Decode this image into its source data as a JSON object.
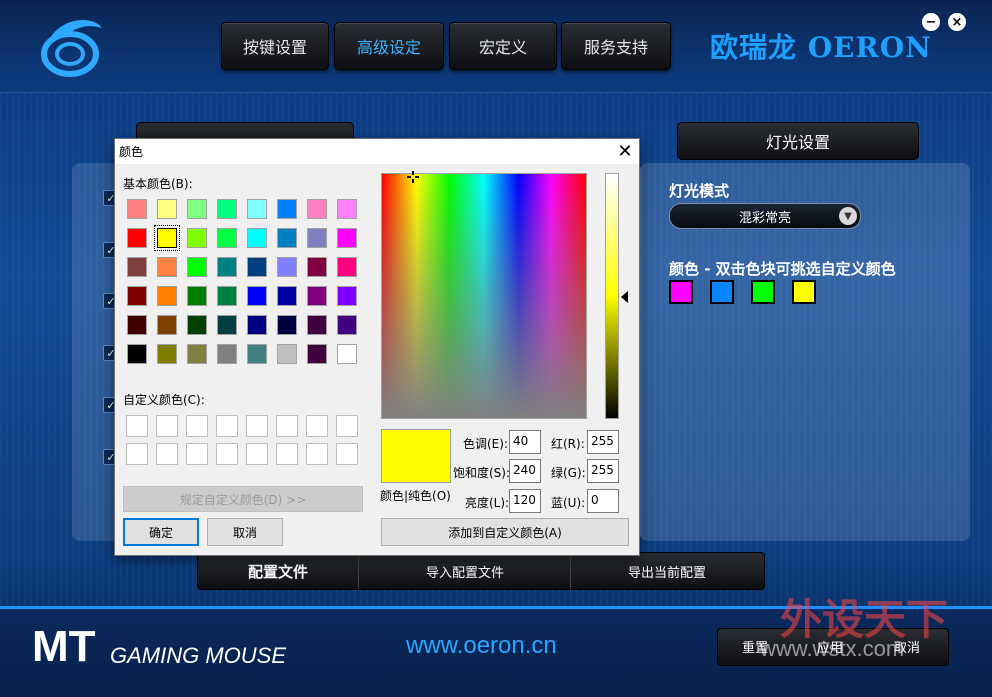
{
  "app": {
    "nav": [
      {
        "label": "按键设置",
        "active": false
      },
      {
        "label": "高级设定",
        "active": true
      },
      {
        "label": "宏定义",
        "active": false
      },
      {
        "label": "服务支持",
        "active": false
      }
    ],
    "brand": "欧瑞龙 OERON",
    "minimize_symbol": "−",
    "close_symbol": "×",
    "settings_tab_label": "",
    "light_tab_label": "灯光设置",
    "light_mode_label": "灯光模式",
    "light_mode_value": "混彩常亮",
    "color_label": "颜色 - 双击色块可挑选自定义颜色",
    "swatches": [
      "#ff00ff",
      "#0a84ff",
      "#00ff00",
      "#ffff00"
    ],
    "check_mark": "✓",
    "config": {
      "label": "配置文件",
      "import": "导入配置文件",
      "export": "导出当前配置"
    },
    "footer": {
      "mt": "MT",
      "gaming": "GAMING MOUSE",
      "site": "www.oeron.cn",
      "reset": "重置",
      "apply": "应用",
      "cancel": "取消"
    },
    "watermark": "外设天下",
    "watermark_site": "www.wstx.com"
  },
  "dialog": {
    "title": "颜色",
    "close": "✕",
    "basic_label": "基本颜色(B):",
    "custom_label": "自定义颜色(C):",
    "basic_colors": [
      [
        "#ff8080",
        "#ffff80",
        "#80ff80",
        "#00ff80",
        "#80ffff",
        "#0080ff",
        "#ff80c0",
        "#ff80ff"
      ],
      [
        "#ff0000",
        "#ffff00",
        "#80ff00",
        "#00ff40",
        "#00ffff",
        "#0080c0",
        "#8080c0",
        "#ff00ff"
      ],
      [
        "#804040",
        "#ff8040",
        "#00ff00",
        "#008080",
        "#004080",
        "#8080ff",
        "#800040",
        "#ff0080"
      ],
      [
        "#800000",
        "#ff8000",
        "#008000",
        "#008040",
        "#0000ff",
        "#0000a0",
        "#800080",
        "#8000ff"
      ],
      [
        "#400000",
        "#804000",
        "#004000",
        "#004040",
        "#000080",
        "#000040",
        "#400040",
        "#400080"
      ],
      [
        "#000000",
        "#808000",
        "#808040",
        "#808080",
        "#408080",
        "#c0c0c0",
        "#400040",
        "#ffffff"
      ]
    ],
    "selected": [
      1,
      1
    ],
    "define_custom": "规定自定义颜色(D) >>",
    "ok": "确定",
    "cancel": "取消",
    "preview_color": "#ffff00",
    "preview_label": "颜色|纯色(O)",
    "hue_label": "色调(E):",
    "hue": "40",
    "sat_label": "饱和度(S):",
    "sat": "240",
    "lum_label": "亮度(L):",
    "lum": "120",
    "red_label": "红(R):",
    "red": "255",
    "green_label": "绿(G):",
    "green": "255",
    "blue_label": "蓝(U):",
    "blue": "0",
    "add_custom": "添加到自定义颜色(A)"
  }
}
